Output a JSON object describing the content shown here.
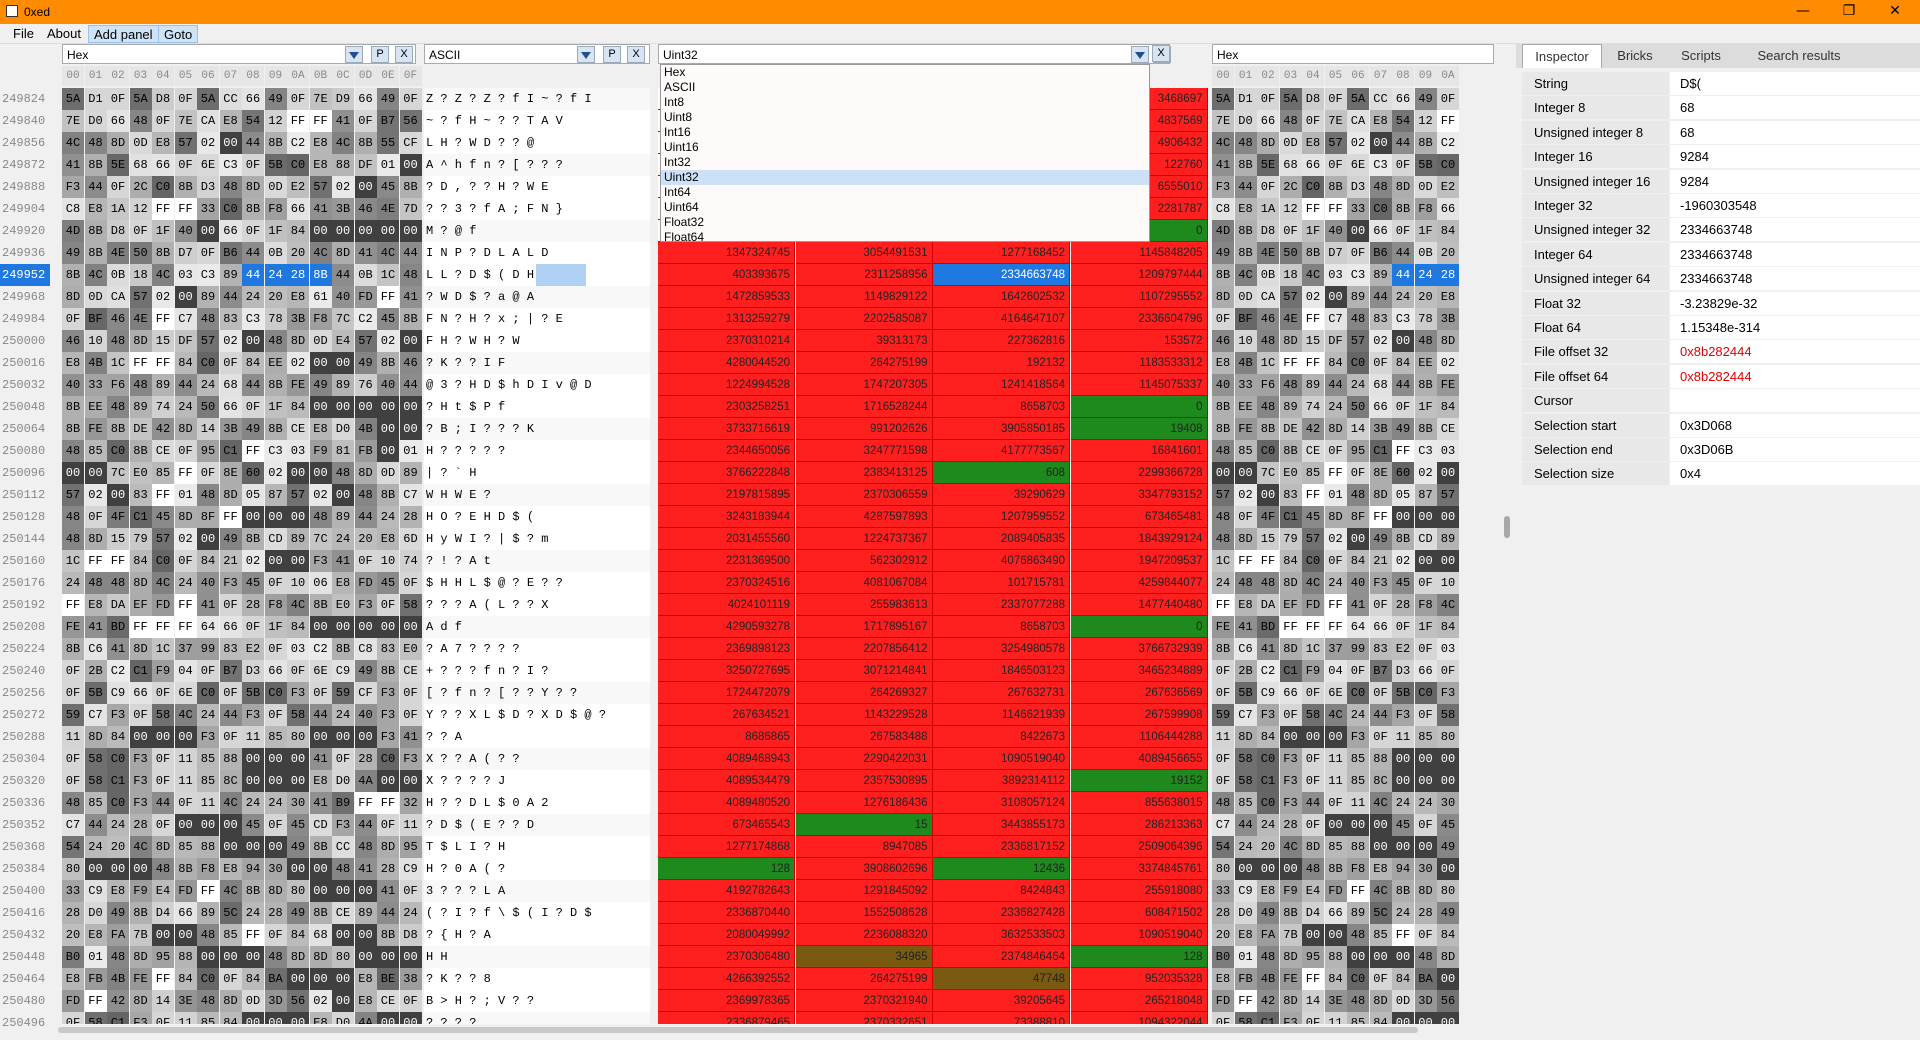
{
  "window": {
    "title": "0xed",
    "min": "—",
    "max": "❐",
    "close": "✕"
  },
  "menu": [
    "File",
    "About",
    "Add panel",
    "Goto"
  ],
  "colors": {
    "accent": "#ff8c00",
    "selection": "#1e78e0",
    "red": "#ff1f1f",
    "green": "#1e8a1e",
    "olive": "#7a5a10"
  },
  "rownumbers": [
    "249824",
    "249840",
    "249856",
    "249872",
    "249888",
    "249904",
    "249920",
    "249936",
    "249952",
    "249968",
    "249984",
    "250000",
    "250016",
    "250032",
    "250048",
    "250064",
    "250080",
    "250096",
    "250112",
    "250128",
    "250144",
    "250160",
    "250176",
    "250192",
    "250208",
    "250224",
    "250240",
    "250256",
    "250272",
    "250288",
    "250304",
    "250320",
    "250336",
    "250352",
    "250368",
    "250384",
    "250400",
    "250416",
    "250432",
    "250448",
    "250464",
    "250480",
    "250496"
  ],
  "panels": {
    "hex1": {
      "name": "Hex",
      "p": "P",
      "x": "X"
    },
    "ascii": {
      "name": "ASCII",
      "p": "P",
      "x": "X"
    },
    "uint32": {
      "name": "Uint32",
      "p": "P",
      "x": "X"
    },
    "hex2": {
      "name": "Hex",
      "p": "P",
      "x": "X"
    }
  },
  "hex_header": [
    "00",
    "01",
    "02",
    "03",
    "04",
    "05",
    "06",
    "07",
    "08",
    "09",
    "0A",
    "0B",
    "0C",
    "0D",
    "0E",
    "0F"
  ],
  "hex_rows": [
    "5A D1 0F 5A D8 0F 5A CC 66 49 0F 7E D9 66 49 0F",
    "7E D0 66 48 0F 7E CA E8 54 12 FF FF 41 0F B7 56",
    "4C 48 8D 0D E8 57 02 00 44 8B C2 E8 4C 8B 55 CF",
    "41 8B 5E 68 66 0F 6E C3 0F 5B C0 E8 88 DF 01 00",
    "F3 44 0F 2C C0 8B D3 48 8D 0D E2 57 02 00 45 8B",
    "C8 E8 1A 12 FF FF 33 C0 8B F8 66 41 3B 46 4E 7D",
    "4D 8B D8 0F 1F 40 00 66 0F 1F 84 00 00 00 00 00",
    "49 8B 4E 50 8B D7 0F B6 44 0B 20 4C 8D 41 4C 44",
    "8B 4C 0B 18 4C 03 C3 89 44 24 28 8B 44 0B 1C 48",
    "8D 0D CA 57 02 00 89 44 24 20 E8 61 40 FD FF 41",
    "0F BF 46 4E FF C7 48 83 C3 78 3B F8 7C C2 45 8B",
    "46 10 48 8D 15 DF 57 02 00 48 8D 0D E4 57 02 00",
    "E8 4B 1C FF FF 84 C0 0F 84 EE 02 00 00 49 8B 46",
    "40 33 F6 48 89 44 24 68 44 8B FE 49 89 76 40 44",
    "8B EE 48 89 74 24 50 66 0F 1F 84 00 00 00 00 00",
    "8B FE 8B DE 42 8D 14 3B 49 8B CE E8 D0 4B 00 00",
    "48 85 C0 8B CE 0F 95 C1 FF C3 03 F9 81 FB 00 01",
    "00 00 7C E0 85 FF 0F 8E 60 02 00 00 48 8D 0D 89",
    "57 02 00 83 FF 01 48 8D 05 87 57 02 00 48 8B C7",
    "48 0F 4F C1 45 8D 8F FF 00 00 00 48 89 44 24 28",
    "48 8D 15 79 57 02 00 49 8B CD 89 7C 24 20 E8 6D",
    "1C FF FF 84 C0 0F 84 21 02 00 00 F3 41 0F 10 74",
    "24 48 48 8D 4C 24 40 F3 45 0F 10 06 E8 FD 45 0F",
    "FF E8 DA EF FD FF 41 0F 28 F8 4C 8B E0 F3 0F 58",
    "FE 41 BD FF FF FF 64 66 0F 1F 84 00 00 00 00 00",
    "8B C6 41 8D 1C 37 99 83 E2 0F 03 C2 8B C8 83 E0",
    "0F 2B C2 C1 F9 04 0F B7 D3 66 0F 6E C9 49 8B CE",
    "0F 5B C9 66 0F 6E C0 0F 5B C0 F3 0F 59 CF F3 0F",
    "59 C7 F3 0F 58 4C 24 44 F3 0F 58 44 24 40 F3 0F",
    "11 8D 84 00 00 00 F3 0F 11 85 80 00 00 00 F3 41",
    "0F 58 C0 F3 0F 11 85 88 00 00 00 41 0F 28 C0 F3",
    "0F 58 C1 F3 0F 11 85 8C 00 00 00 E8 D0 4A 00 00",
    "48 85 C0 F3 44 0F 11 4C 24 24 30 41 B9 FF FF 32",
    "C7 44 24 28 0F 00 00 00 45 0F 45 CD F3 44 0F 11",
    "54 24 20 4C 8D 85 88 00 00 00 49 8B CC 48 8D 95",
    "80 00 00 00 48 8B F8 E8 94 30 00 00 48 41 28 C9",
    "33 C9 E8 F9 E4 FD FF 4C 8B 8D 80 00 00 00 41 0F",
    "28 D0 49 8B D4 66 89 5C 24 28 49 8B CE 89 44 24",
    "20 E8 FA 7B 00 00 48 85 FF 0F 84 68 00 00 8B D8",
    "B0 01 48 8D 95 88 00 00 00 48 8D 8D 80 00 00 00",
    "E8 FB 4B FE FF 84 C0 0F 84 BA 00 00 00 E8 BE 38",
    "FD FF 42 8D 14 3E 48 8D 0D 3D 56 02 00 E8 CE 0F",
    "0F 58 C1 F3 0F 11 85 84 00 00 00 E8 D0 4A 00 00"
  ],
  "ascii_rows": [
    "Z ? Z ? Z ? f I ~ ? f I",
    "~ ? f H ~ ? ? T A V",
    "L H ? W D ? ? @",
    "A ^ h f n ? [ ? ? ?",
    "? D , ? ? H ? W E",
    "? ? 3 ? f A ; F N }",
    "M ? @ f",
    "I N P ? D L A L D",
    "L L ? D $ ( D H",
    "? W D $ ? a @ A",
    "F N ? H ? x ; | ? E",
    "F H ? W H ? W",
    "? K ? ? I F",
    "@ 3 ? H D $ h D I v @ D",
    "? H t $ P f",
    "? B ; I ? ? ? K",
    "H ? ? ? ? ?",
    "| ? ` H",
    "W H W E ?",
    "H O ? E H D $ (",
    "H y W I ? | $ ? m",
    "? ! ? A t",
    "$ H H L $ @ ? E ? ?",
    "? ? ? A ( L ? ? X",
    "A d f",
    "? A 7 ? ? ? ?",
    "+ ? ? ? f n ? I ?",
    "[ ? f n ? [ ? ? Y ? ?",
    "Y ? ? X L $ D ? X D $ @ ?",
    "? ? A",
    "X ? ? A ( ? ?",
    "X ? ? ? ? J",
    "H ? ? D L $ 0 A 2",
    "? D $ ( E ? ? D",
    "T $ L I ? H",
    "H ? 0 A ( ?",
    "3 ? ? ? L A",
    "( ? I ? f \\ $ ( I ? D $",
    "? { H ? A",
    "H H",
    "? K ? ? 8",
    "B > H ? ; V ? ?",
    "? ? ? ?"
  ],
  "uint32_rows": [
    [
      "",
      "",
      "",
      "3468697"
    ],
    [
      "",
      "",
      "",
      "4837569"
    ],
    [
      "",
      "",
      "",
      "4906432"
    ],
    [
      "",
      "",
      "",
      "122760"
    ],
    [
      "",
      "",
      "",
      "6555010"
    ],
    [
      "",
      "",
      "",
      "2281787"
    ],
    [
      "",
      "",
      "",
      "0"
    ],
    [
      "1347324745",
      "3054491531",
      "1277168452",
      "1145848205"
    ],
    [
      "403393675",
      "2311258956",
      "2334663748",
      "1209797444"
    ],
    [
      "1472859533",
      "1149829122",
      "1642602532",
      "1107295552"
    ],
    [
      "1313259279",
      "2202585087",
      "4164647107",
      "2336604796"
    ],
    [
      "2370310214",
      "39313173",
      "227362816",
      "153572"
    ],
    [
      "4280044520",
      "264275199",
      "192132",
      "1183533312"
    ],
    [
      "1224994528",
      "1747207305",
      "1241418564",
      "1145075337"
    ],
    [
      "2303258251",
      "1716528244",
      "8658703",
      "0"
    ],
    [
      "3733716619",
      "991202626",
      "3905850185",
      "19408"
    ],
    [
      "2344650056",
      "3247771598",
      "4177773567",
      "16841601"
    ],
    [
      "3766222848",
      "2383413125",
      "608",
      "2299366728"
    ],
    [
      "2197815895",
      "2370306559",
      "39290629",
      "3347793152"
    ],
    [
      "3243183944",
      "4287597893",
      "1207959552",
      "673465481"
    ],
    [
      "2031455560",
      "1224737367",
      "2089405835",
      "1843929124"
    ],
    [
      "2231369500",
      "562302912",
      "4076863490",
      "1947209537"
    ],
    [
      "2370324516",
      "4081067084",
      "101715781",
      "4259844077"
    ],
    [
      "4024101119",
      "255983613",
      "2337077288",
      "1477440480"
    ],
    [
      "4290593278",
      "1717895167",
      "8658703",
      "0"
    ],
    [
      "2369898123",
      "2207856412",
      "3254980578",
      "3766732939"
    ],
    [
      "3250727695",
      "3071214841",
      "1846503123",
      "3465234889"
    ],
    [
      "1724472079",
      "264269327",
      "267632731",
      "267636569"
    ],
    [
      "267634521",
      "1143229528",
      "1146621939",
      "267599908"
    ],
    [
      "8686865",
      "267583488",
      "8422673",
      "1106444288"
    ],
    [
      "4089468943",
      "2290422031",
      "1090519040",
      "4089456655"
    ],
    [
      "4089534479",
      "2357530895",
      "3892314112",
      "19152"
    ],
    [
      "4089480520",
      "1276186436",
      "3108057124",
      "855638015"
    ],
    [
      "673465543",
      "15",
      "3443855173",
      "286213363"
    ],
    [
      "1277174868",
      "8947085",
      "2336817152",
      "2509064396"
    ],
    [
      "128",
      "3908602696",
      "12436",
      "3374845761"
    ],
    [
      "4192782643",
      "1291845092",
      "8424843",
      "255918080"
    ],
    [
      "2336870440",
      "1552508628",
      "2336827428",
      "608471502"
    ],
    [
      "2080049992",
      "2236088320",
      "3632533503",
      "1090519040"
    ],
    [
      "2370306480",
      "34965",
      "2374846464",
      "128"
    ],
    [
      "4266392552",
      "264275199",
      "47748",
      "952035328"
    ],
    [
      "2369978365",
      "2370321940",
      "39205645",
      "265218048"
    ],
    [
      "2336879465",
      "2370332651",
      "73388810",
      "1094322044"
    ]
  ],
  "type_list": [
    "Hex",
    "ASCII",
    "Int8",
    "Uint8",
    "Int16",
    "Uint16",
    "Int32",
    "Uint32",
    "Int64",
    "Uint64",
    "Float32",
    "Float64"
  ],
  "inspector": {
    "tabs": [
      "Inspector",
      "Bricks",
      "Scripts",
      "Search results"
    ],
    "rows": [
      {
        "k": "String",
        "v": "D$("
      },
      {
        "k": "Integer 8",
        "v": "68"
      },
      {
        "k": "Unsigned integer 8",
        "v": "68"
      },
      {
        "k": "Integer 16",
        "v": "9284"
      },
      {
        "k": "Unsigned integer 16",
        "v": "9284"
      },
      {
        "k": "Integer 32",
        "v": "-1960303548"
      },
      {
        "k": "Unsigned integer 32",
        "v": "2334663748"
      },
      {
        "k": "Integer 64",
        "v": "2334663748"
      },
      {
        "k": "Unsigned integer 64",
        "v": "2334663748"
      },
      {
        "k": "Float 32",
        "v": "-3.23829e-32"
      },
      {
        "k": "Float 64",
        "v": "1.15348e-314"
      },
      {
        "k": "File offset 32",
        "v": "0x8b282444",
        "red": true
      },
      {
        "k": "File offset 64",
        "v": "0x8b282444",
        "red": true
      },
      {
        "k": "Cursor",
        "v": ""
      },
      {
        "k": "Selection start",
        "v": "0x3D068"
      },
      {
        "k": "Selection end",
        "v": "0x3D06B"
      },
      {
        "k": "Selection size",
        "v": "0x4"
      }
    ]
  }
}
